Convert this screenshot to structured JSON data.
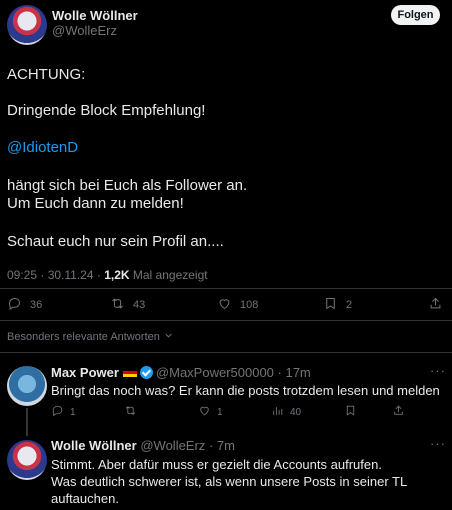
{
  "post": {
    "author_name": "Wolle Wöllner",
    "author_handle": "@WolleErz",
    "follow_label": "Folgen",
    "lines": {
      "l1": "ACHTUNG:",
      "l2": "Dringende Block Empfehlung!",
      "mention": "@IdiotenD",
      "l4a": "hängt sich bei Euch als Follower an.",
      "l4b": "Um Euch dann zu melden!",
      "l5": "Schaut euch nur sein Profil an...."
    },
    "meta": {
      "time_date": "09:25 · 30.11.24 · ",
      "views_count": "1,2K",
      "views_label": " Mal angezeigt"
    },
    "actions": {
      "replies": "36",
      "reposts": "43",
      "likes": "108",
      "bookmarks": "2"
    },
    "icons": [
      "reply-icon",
      "repost-icon",
      "like-icon",
      "bookmark-icon",
      "share-icon"
    ]
  },
  "sort": {
    "label": "Besonders relevante Antworten"
  },
  "replies": [
    {
      "name": "Max Power",
      "handle": "@MaxPower500000",
      "time": "· 17m",
      "text": "Bringt das noch was? Er kann die posts trotzdem lesen und melden",
      "replies": "1",
      "reposts": "",
      "likes": "1",
      "views": "40"
    },
    {
      "name": "Wolle Wöllner",
      "handle": "@WolleErz",
      "time": "· 7m",
      "text_l1": "Stimmt. Aber dafür muss er gezielt die Accounts aufrufen.",
      "text_l2": "Was deutlich schwerer ist, als wenn unsere Posts in seiner TL",
      "text_l3": "auftauchen."
    }
  ],
  "colors": {
    "background": "#000000",
    "text": "#e7e9ea",
    "muted": "#71767b",
    "link": "#1d9bf0",
    "separator": "#2f3336"
  }
}
